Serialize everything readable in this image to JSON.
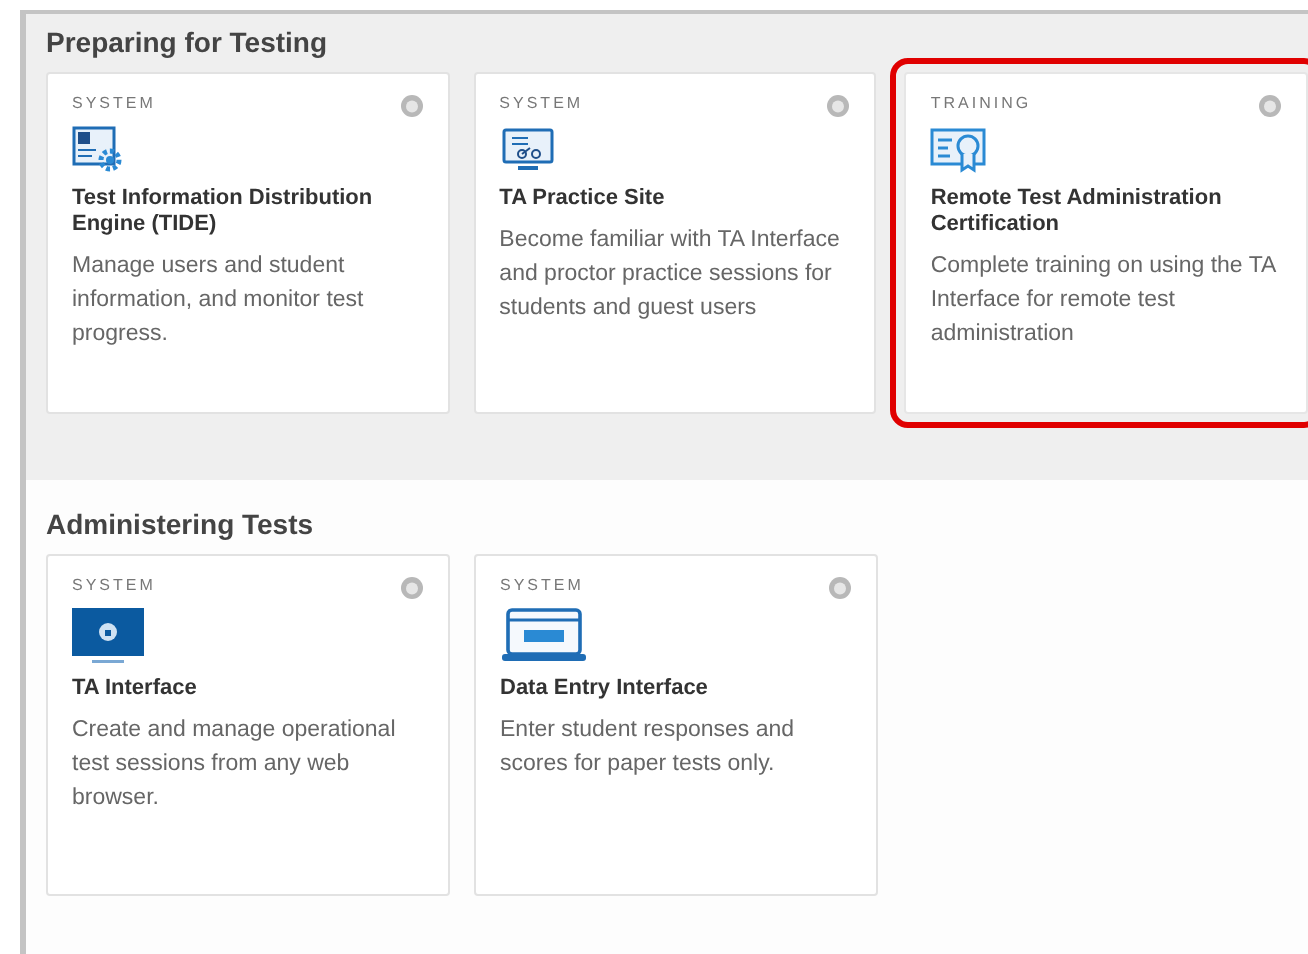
{
  "sections": [
    {
      "title": "Preparing for Testing",
      "cards": [
        {
          "category": "SYSTEM",
          "kind": "tide",
          "title": "Test Information Distribution Engine (TIDE)",
          "description": "Manage users and student information, and monitor test progress.",
          "highlighted": false
        },
        {
          "category": "SYSTEM",
          "kind": "practice",
          "title": "TA Practice Site",
          "description": "Become familiar with TA Interface and proctor practice sessions for students and guest users",
          "highlighted": false
        },
        {
          "category": "TRAINING",
          "kind": "certificate",
          "title": "Remote Test Administration Certification",
          "description": "Complete training on using the TA Interface for remote test administration",
          "highlighted": true
        }
      ]
    },
    {
      "title": "Administering Tests",
      "cards": [
        {
          "category": "SYSTEM",
          "kind": "lock-monitor",
          "title": "TA Interface",
          "description": "Create and manage operational test sessions from any web browser."
        },
        {
          "category": "SYSTEM",
          "kind": "laptop",
          "title": "Data Entry Interface",
          "description": "Enter student responses and scores for paper tests only."
        }
      ]
    }
  ]
}
